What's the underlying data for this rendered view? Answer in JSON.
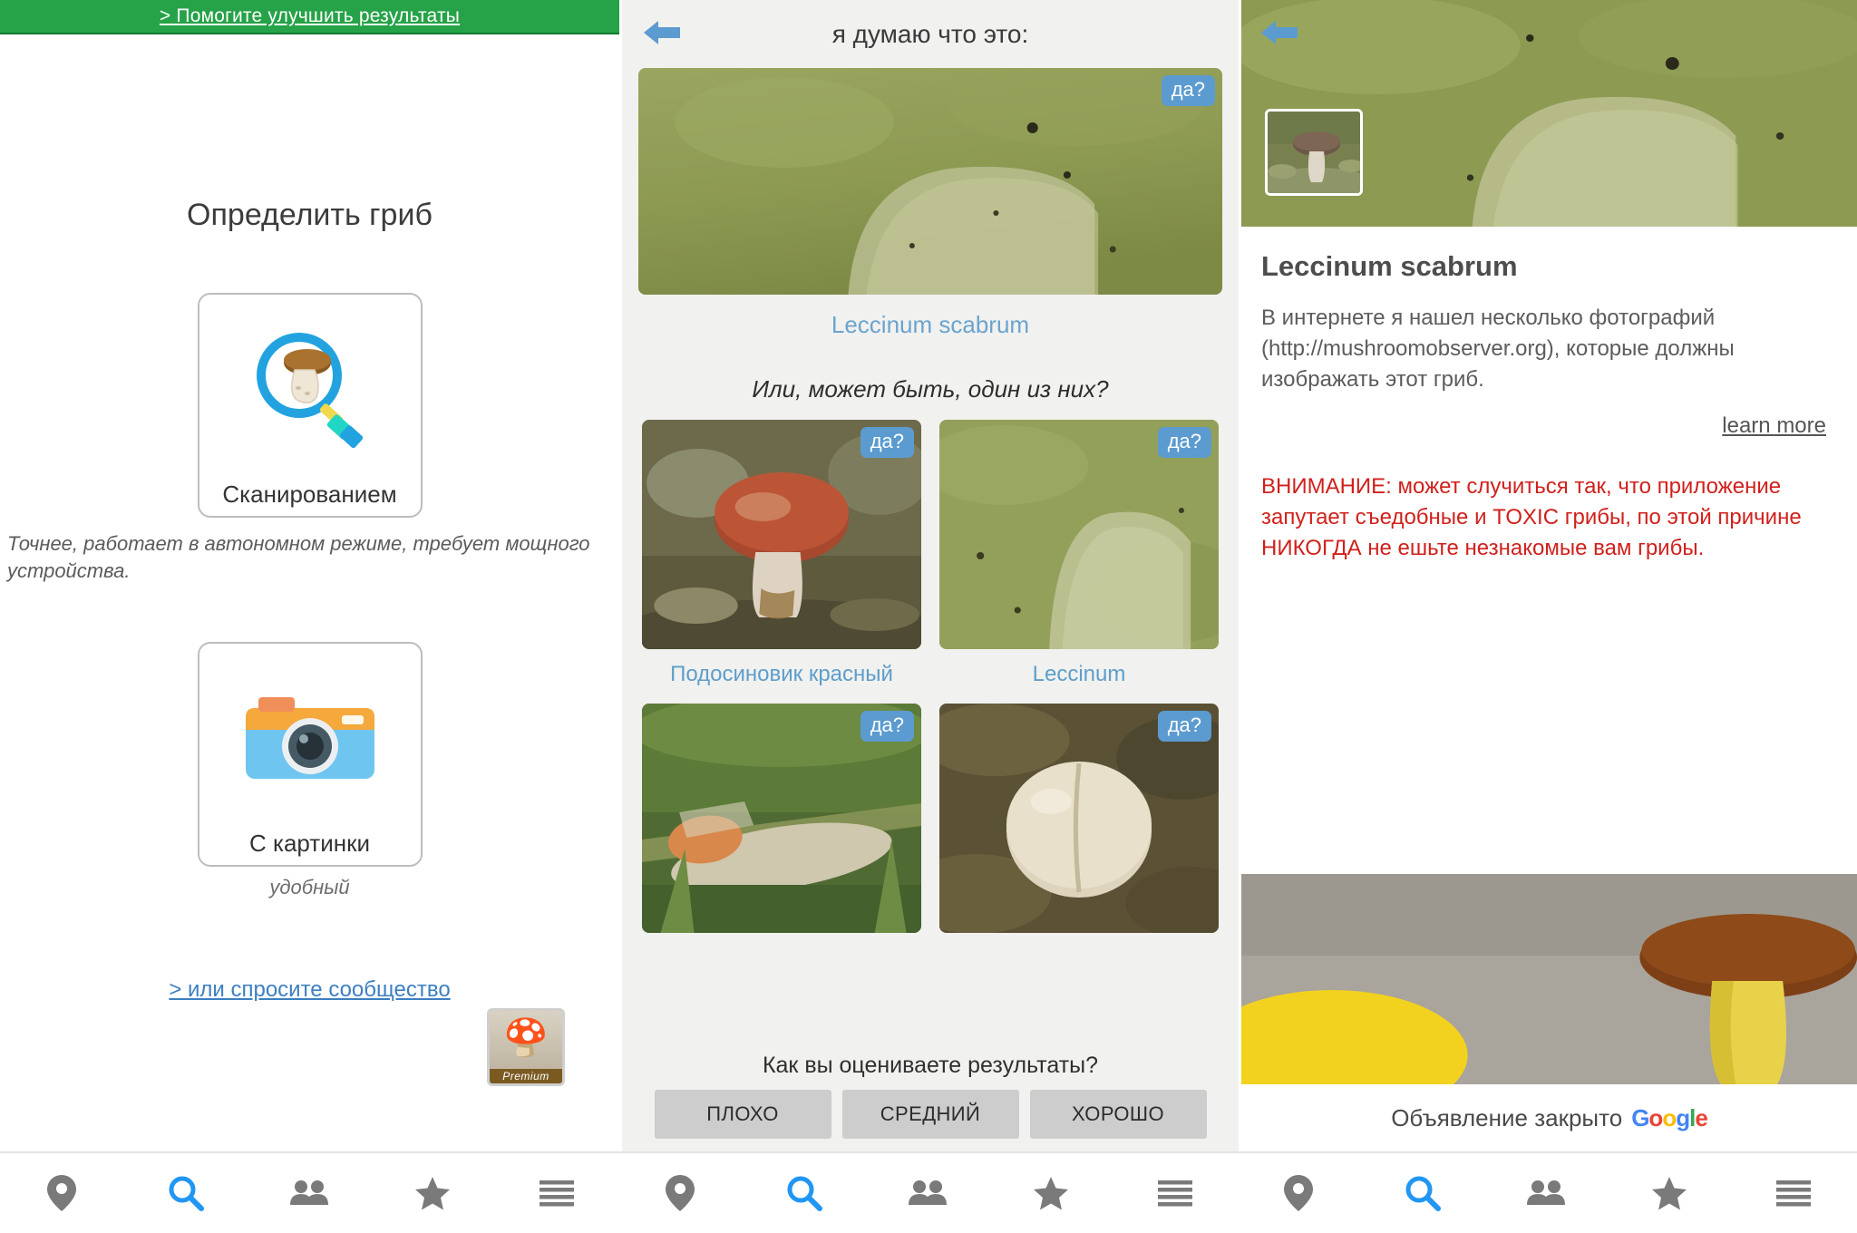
{
  "panel_left": {
    "banner": {
      "label": "> Помогите улучшить результаты"
    },
    "title": "Определить гриб",
    "scan_tile": {
      "label": "Сканированием",
      "icon": "mushroom-magnifier-icon"
    },
    "scan_note": "Точнее, работает в автономном режиме, требует мощного устройства.",
    "picture_tile": {
      "label": "С картинки",
      "icon": "camera-icon"
    },
    "picture_note": "удобный",
    "community_link": "> или спросите сообщество",
    "premium_badge": {
      "label": "Premium",
      "icon": "mushroom-magnifier-icon"
    }
  },
  "panel_middle": {
    "back_icon": "back-arrow-icon",
    "header": "я думаю что это:",
    "hero": {
      "badge": "да?",
      "caption": "Leccinum scabrum",
      "alt": "mushroom-stem-closeup-photo"
    },
    "alternatives_question": "Или, может быть, один из них?",
    "alternatives": [
      {
        "badge": "да?",
        "caption": "Подосиновик красный",
        "alt": "red-cap-bolete-photo"
      },
      {
        "badge": "да?",
        "caption": "Leccinum",
        "alt": "green-stem-photo"
      },
      {
        "badge": "да?",
        "caption": "",
        "alt": "orange-bolete-grass-photo"
      },
      {
        "badge": "да?",
        "caption": "",
        "alt": "pale-mushroom-leaves-photo"
      }
    ],
    "rating": {
      "question": "Как вы оцениваете результаты?",
      "buttons": [
        "ПЛОХО",
        "СРЕДНИЙ",
        "ХОРОШО"
      ]
    }
  },
  "panel_right": {
    "back_icon": "back-arrow-icon",
    "hero_alt": "mushroom-stem-closeup-photo",
    "thumb_alt": "mushroom-thumbnail-photo",
    "sci_name": "Leccinum scabrum",
    "description": "В интернете я нашел несколько фотографий (http://mushroomobserver.org), которые должны изображать этот гриб.",
    "learn_more": "learn more",
    "warning": "ВНИМАНИЕ: может случиться так, что приложение запутает съедобные и TOXIC грибы, по этой причине НИКОГДА не ешьте незнакомые вам грибы.",
    "ad_alt": "yellow-bolete-mushroom-ad-photo",
    "ad_footer_text": "Объявление закрыто",
    "ad_brand": "Google"
  },
  "bottom_nav": {
    "items": [
      {
        "icon": "location-pin-icon",
        "active": false
      },
      {
        "icon": "search-icon",
        "active": true
      },
      {
        "icon": "people-icon",
        "active": false
      },
      {
        "icon": "star-icon",
        "active": false
      },
      {
        "icon": "menu-icon",
        "active": false
      }
    ]
  },
  "colors": {
    "banner_green": "#26a248",
    "accent_blue": "#5b9bd0",
    "link_blue": "#6ba4cf",
    "warning_red": "#d0211c",
    "panel_gray": "#f1f1ef"
  }
}
